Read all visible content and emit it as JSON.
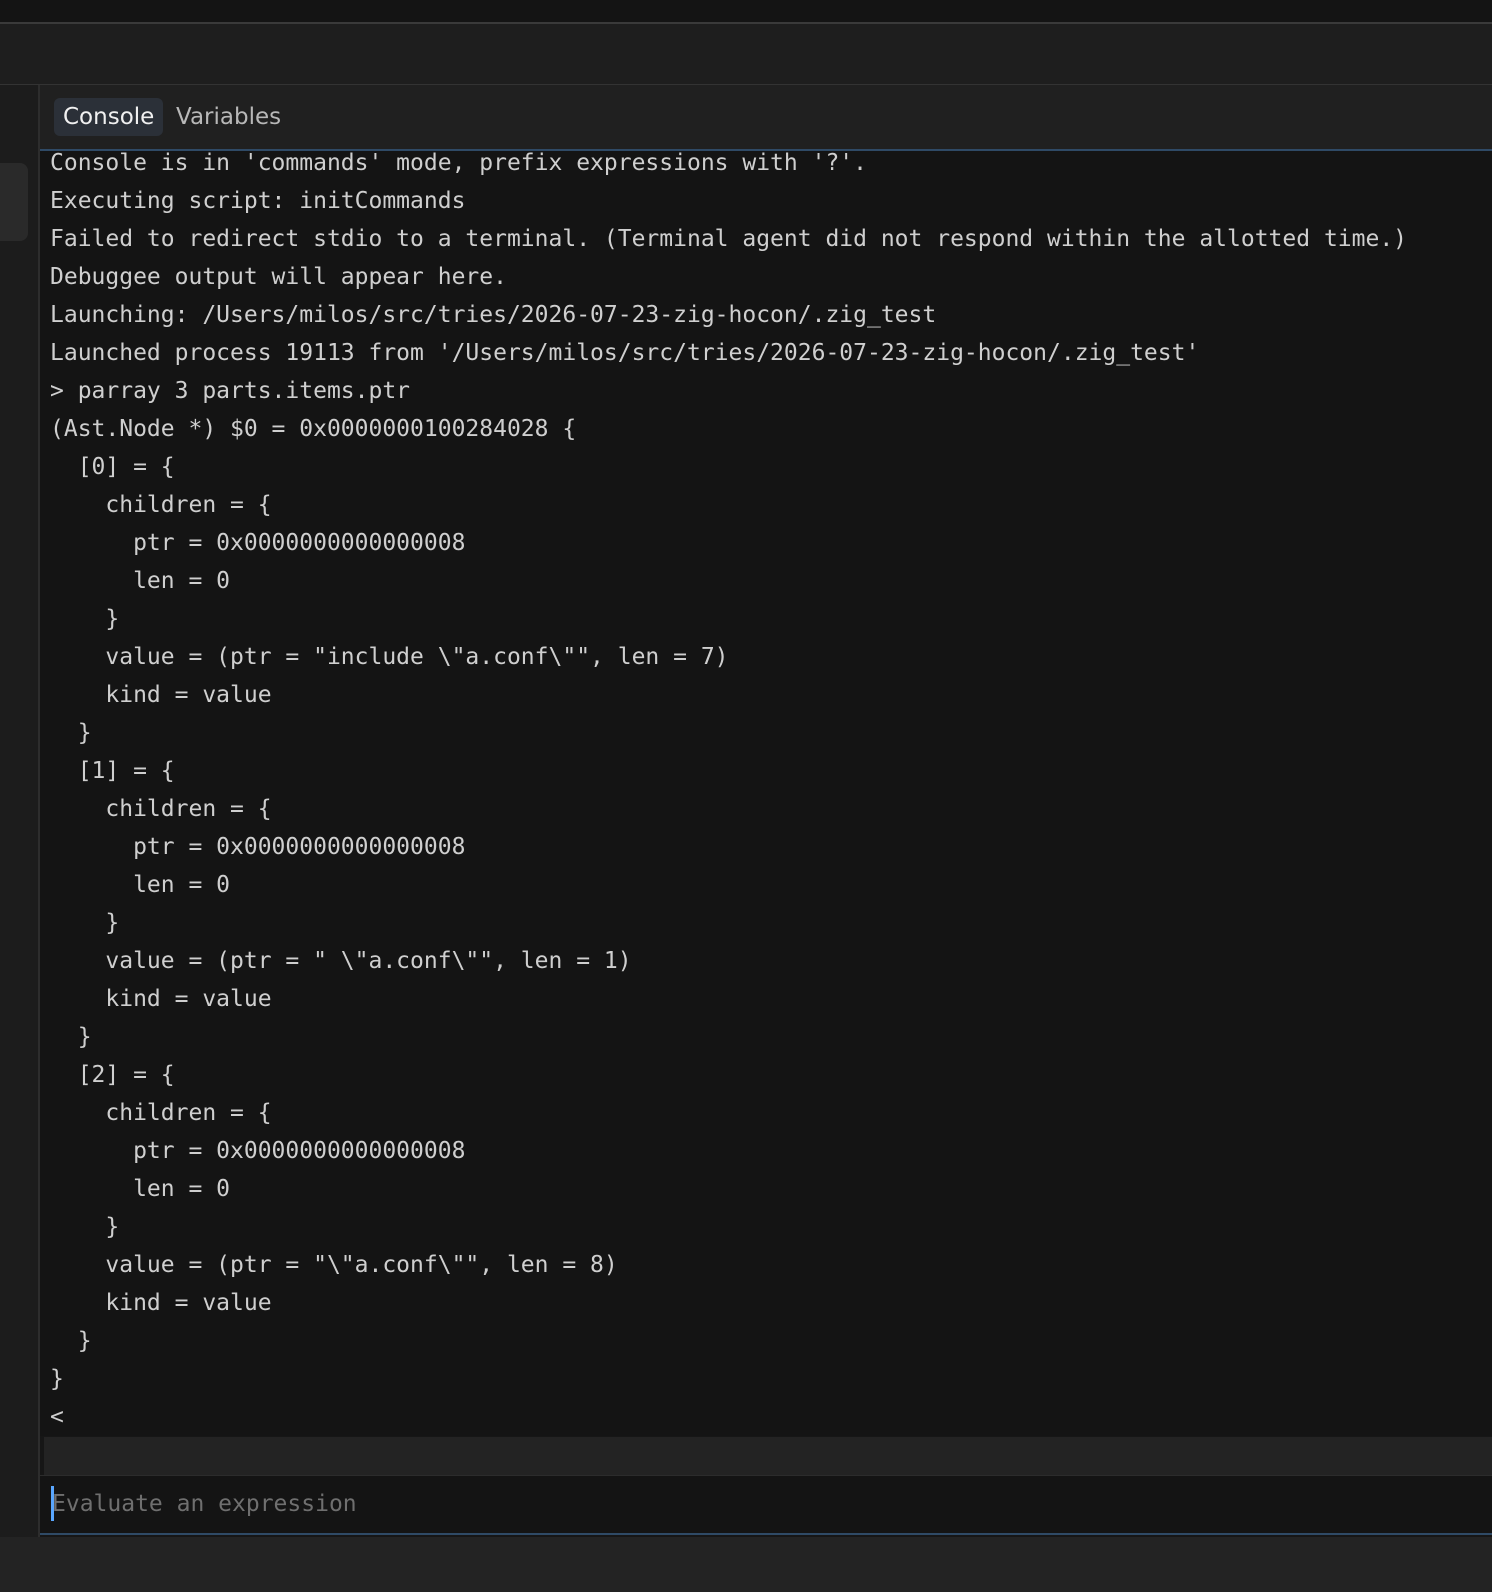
{
  "tabs": {
    "console": "Console",
    "variables": "Variables"
  },
  "console": {
    "lines": [
      "Console is in 'commands' mode, prefix expressions with '?'.",
      "Executing script: initCommands",
      "Failed to redirect stdio to a terminal. (Terminal agent did not respond within the allotted time.)",
      "Debuggee output will appear here.",
      "Launching: /Users/milos/src/tries/2026-07-23-zig-hocon/.zig_test",
      "Launched process 19113 from '/Users/milos/src/tries/2026-07-23-zig-hocon/.zig_test'",
      "> parray 3 parts.items.ptr",
      "(Ast.Node *) $0 = 0x0000000100284028 {",
      "  [0] = {",
      "    children = {",
      "      ptr = 0x0000000000000008",
      "      len = 0",
      "    }",
      "    value = (ptr = \"include \\\"a.conf\\\"\", len = 7)",
      "    kind = value",
      "  }",
      "  [1] = {",
      "    children = {",
      "      ptr = 0x0000000000000008",
      "      len = 0",
      "    }",
      "    value = (ptr = \" \\\"a.conf\\\"\", len = 1)",
      "    kind = value",
      "  }",
      "  [2] = {",
      "    children = {",
      "      ptr = 0x0000000000000008",
      "      len = 0",
      "    }",
      "    value = (ptr = \"\\\"a.conf\\\"\", len = 8)",
      "    kind = value",
      "  }",
      "}",
      "<"
    ]
  },
  "input": {
    "placeholder": "Evaluate an expression",
    "value": ""
  },
  "colors": {
    "accent": "#5aa7ff",
    "active_tab_bg": "#2b3038",
    "background": "#141414"
  }
}
